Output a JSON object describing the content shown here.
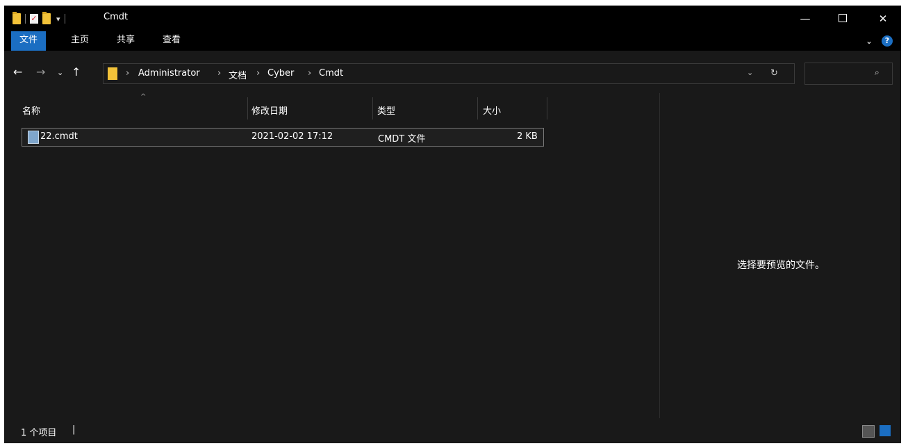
{
  "window": {
    "title": "Cmdt",
    "minimize_icon": "minimize-icon",
    "maximize_icon": "maximize-icon",
    "close_icon": "close-icon"
  },
  "ribbon": {
    "tabs": [
      {
        "label": "文件",
        "active": true
      },
      {
        "label": "主页",
        "active": false
      },
      {
        "label": "共享",
        "active": false
      },
      {
        "label": "查看",
        "active": false
      }
    ],
    "accent": "#1b6ec2"
  },
  "nav": {
    "breadcrumb": [
      "Administrator",
      "文档",
      "Cyber",
      "Cmdt"
    ],
    "search_placeholder": ""
  },
  "columns": {
    "name": "名称",
    "modified": "修改日期",
    "type": "类型",
    "size": "大小"
  },
  "files": [
    {
      "name": "22.cmdt",
      "modified": "2021-02-02 17:12",
      "type": "CMDT 文件",
      "size": "2 KB",
      "icon": "notepad-file-icon"
    }
  ],
  "preview": {
    "message": "选择要预览的文件。"
  },
  "status": {
    "item_count": "1 个项目"
  }
}
